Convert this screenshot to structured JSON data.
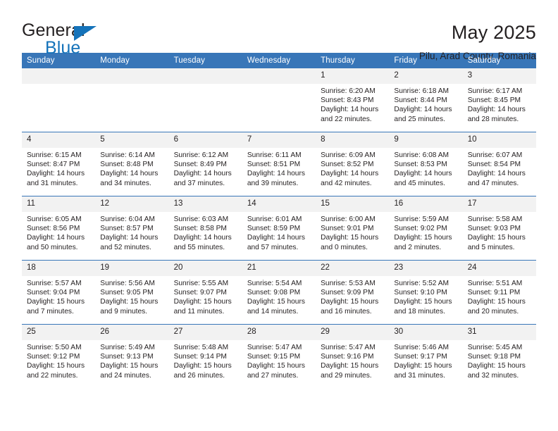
{
  "brand": {
    "name_part1": "General",
    "name_part2": "Blue",
    "flag_icon": "brand-flag-icon",
    "accent_color": "#1573ba"
  },
  "header": {
    "title": "May 2025",
    "subtitle": "Pilu, Arad County, Romania"
  },
  "theme": {
    "header_bg": "#3876b8",
    "daynum_bg": "#f2f2f2",
    "text": "#231f20"
  },
  "calendar": {
    "weekday_headers": [
      "Sunday",
      "Monday",
      "Tuesday",
      "Wednesday",
      "Thursday",
      "Friday",
      "Saturday"
    ],
    "labels": {
      "sunrise": "Sunrise:",
      "sunset": "Sunset:",
      "daylight": "Daylight:"
    },
    "weeks": [
      [
        {
          "day": "",
          "empty": true
        },
        {
          "day": "",
          "empty": true
        },
        {
          "day": "",
          "empty": true
        },
        {
          "day": "",
          "empty": true
        },
        {
          "day": "1",
          "sunrise": "Sunrise: 6:20 AM",
          "sunset": "Sunset: 8:43 PM",
          "daylight": "Daylight: 14 hours and 22 minutes."
        },
        {
          "day": "2",
          "sunrise": "Sunrise: 6:18 AM",
          "sunset": "Sunset: 8:44 PM",
          "daylight": "Daylight: 14 hours and 25 minutes."
        },
        {
          "day": "3",
          "sunrise": "Sunrise: 6:17 AM",
          "sunset": "Sunset: 8:45 PM",
          "daylight": "Daylight: 14 hours and 28 minutes."
        }
      ],
      [
        {
          "day": "4",
          "sunrise": "Sunrise: 6:15 AM",
          "sunset": "Sunset: 8:47 PM",
          "daylight": "Daylight: 14 hours and 31 minutes."
        },
        {
          "day": "5",
          "sunrise": "Sunrise: 6:14 AM",
          "sunset": "Sunset: 8:48 PM",
          "daylight": "Daylight: 14 hours and 34 minutes."
        },
        {
          "day": "6",
          "sunrise": "Sunrise: 6:12 AM",
          "sunset": "Sunset: 8:49 PM",
          "daylight": "Daylight: 14 hours and 37 minutes."
        },
        {
          "day": "7",
          "sunrise": "Sunrise: 6:11 AM",
          "sunset": "Sunset: 8:51 PM",
          "daylight": "Daylight: 14 hours and 39 minutes."
        },
        {
          "day": "8",
          "sunrise": "Sunrise: 6:09 AM",
          "sunset": "Sunset: 8:52 PM",
          "daylight": "Daylight: 14 hours and 42 minutes."
        },
        {
          "day": "9",
          "sunrise": "Sunrise: 6:08 AM",
          "sunset": "Sunset: 8:53 PM",
          "daylight": "Daylight: 14 hours and 45 minutes."
        },
        {
          "day": "10",
          "sunrise": "Sunrise: 6:07 AM",
          "sunset": "Sunset: 8:54 PM",
          "daylight": "Daylight: 14 hours and 47 minutes."
        }
      ],
      [
        {
          "day": "11",
          "sunrise": "Sunrise: 6:05 AM",
          "sunset": "Sunset: 8:56 PM",
          "daylight": "Daylight: 14 hours and 50 minutes."
        },
        {
          "day": "12",
          "sunrise": "Sunrise: 6:04 AM",
          "sunset": "Sunset: 8:57 PM",
          "daylight": "Daylight: 14 hours and 52 minutes."
        },
        {
          "day": "13",
          "sunrise": "Sunrise: 6:03 AM",
          "sunset": "Sunset: 8:58 PM",
          "daylight": "Daylight: 14 hours and 55 minutes."
        },
        {
          "day": "14",
          "sunrise": "Sunrise: 6:01 AM",
          "sunset": "Sunset: 8:59 PM",
          "daylight": "Daylight: 14 hours and 57 minutes."
        },
        {
          "day": "15",
          "sunrise": "Sunrise: 6:00 AM",
          "sunset": "Sunset: 9:01 PM",
          "daylight": "Daylight: 15 hours and 0 minutes."
        },
        {
          "day": "16",
          "sunrise": "Sunrise: 5:59 AM",
          "sunset": "Sunset: 9:02 PM",
          "daylight": "Daylight: 15 hours and 2 minutes."
        },
        {
          "day": "17",
          "sunrise": "Sunrise: 5:58 AM",
          "sunset": "Sunset: 9:03 PM",
          "daylight": "Daylight: 15 hours and 5 minutes."
        }
      ],
      [
        {
          "day": "18",
          "sunrise": "Sunrise: 5:57 AM",
          "sunset": "Sunset: 9:04 PM",
          "daylight": "Daylight: 15 hours and 7 minutes."
        },
        {
          "day": "19",
          "sunrise": "Sunrise: 5:56 AM",
          "sunset": "Sunset: 9:05 PM",
          "daylight": "Daylight: 15 hours and 9 minutes."
        },
        {
          "day": "20",
          "sunrise": "Sunrise: 5:55 AM",
          "sunset": "Sunset: 9:07 PM",
          "daylight": "Daylight: 15 hours and 11 minutes."
        },
        {
          "day": "21",
          "sunrise": "Sunrise: 5:54 AM",
          "sunset": "Sunset: 9:08 PM",
          "daylight": "Daylight: 15 hours and 14 minutes."
        },
        {
          "day": "22",
          "sunrise": "Sunrise: 5:53 AM",
          "sunset": "Sunset: 9:09 PM",
          "daylight": "Daylight: 15 hours and 16 minutes."
        },
        {
          "day": "23",
          "sunrise": "Sunrise: 5:52 AM",
          "sunset": "Sunset: 9:10 PM",
          "daylight": "Daylight: 15 hours and 18 minutes."
        },
        {
          "day": "24",
          "sunrise": "Sunrise: 5:51 AM",
          "sunset": "Sunset: 9:11 PM",
          "daylight": "Daylight: 15 hours and 20 minutes."
        }
      ],
      [
        {
          "day": "25",
          "sunrise": "Sunrise: 5:50 AM",
          "sunset": "Sunset: 9:12 PM",
          "daylight": "Daylight: 15 hours and 22 minutes."
        },
        {
          "day": "26",
          "sunrise": "Sunrise: 5:49 AM",
          "sunset": "Sunset: 9:13 PM",
          "daylight": "Daylight: 15 hours and 24 minutes."
        },
        {
          "day": "27",
          "sunrise": "Sunrise: 5:48 AM",
          "sunset": "Sunset: 9:14 PM",
          "daylight": "Daylight: 15 hours and 26 minutes."
        },
        {
          "day": "28",
          "sunrise": "Sunrise: 5:47 AM",
          "sunset": "Sunset: 9:15 PM",
          "daylight": "Daylight: 15 hours and 27 minutes."
        },
        {
          "day": "29",
          "sunrise": "Sunrise: 5:47 AM",
          "sunset": "Sunset: 9:16 PM",
          "daylight": "Daylight: 15 hours and 29 minutes."
        },
        {
          "day": "30",
          "sunrise": "Sunrise: 5:46 AM",
          "sunset": "Sunset: 9:17 PM",
          "daylight": "Daylight: 15 hours and 31 minutes."
        },
        {
          "day": "31",
          "sunrise": "Sunrise: 5:45 AM",
          "sunset": "Sunset: 9:18 PM",
          "daylight": "Daylight: 15 hours and 32 minutes."
        }
      ]
    ]
  }
}
